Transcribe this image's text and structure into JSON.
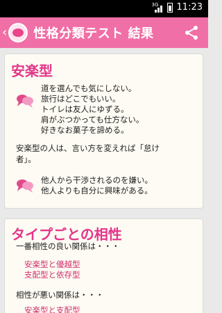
{
  "status": {
    "network": "3G",
    "time": "11:23"
  },
  "appbar": {
    "title": "性格分類テスト 結果"
  },
  "type_card": {
    "title": "安楽型",
    "traits_1": [
      "道を選んでも気にしない。",
      "旅行はどこでもいい。",
      "トイレは友人にゆずる。",
      "肩がぶつかっても仕方ない。",
      "好きなお菓子を諦める。"
    ],
    "description": [
      "安楽型の人は、言い方を変えれば「怠け",
      "者」。"
    ],
    "traits_2": [
      "他人から干渉されるのを嫌い。",
      "他人よりも自分に興味がある。"
    ]
  },
  "compat_card": {
    "title": "タイプごとの相性",
    "best_label": "一番相性の良い関係は・・・",
    "best_pairs": [
      "安楽型と優越型",
      "支配型と依存型"
    ],
    "bad_label": "相性が悪い関係は・・・",
    "bad_pairs": [
      "安楽型と支配型"
    ]
  },
  "colors": {
    "accent": "#f06fa6",
    "title_pink": "#e3368a",
    "card_bg": "#fdfbf3"
  }
}
